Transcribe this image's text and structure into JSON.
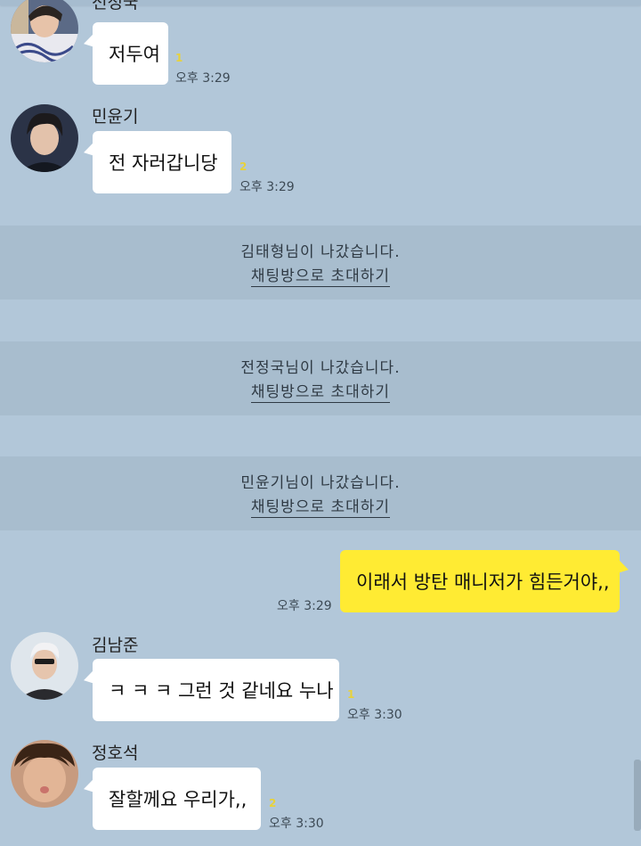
{
  "messages_top": [
    {
      "sender": "전정국",
      "text": "저두여",
      "unread": "1",
      "time": "오후 3:29"
    },
    {
      "sender": "민윤기",
      "text": "전 자러갑니당",
      "unread": "2",
      "time": "오후 3:29"
    }
  ],
  "notices": [
    {
      "text": "김태형님이 나갔습니다.",
      "link": "채팅방으로 초대하기"
    },
    {
      "text": "전정국님이 나갔습니다.",
      "link": "채팅방으로 초대하기"
    },
    {
      "text": "민윤기님이 나갔습니다.",
      "link": "채팅방으로 초대하기"
    }
  ],
  "my_message": {
    "text": "이래서 방탄 매니저가 힘든거야,,",
    "time": "오후 3:29"
  },
  "messages_bottom": [
    {
      "sender": "김남준",
      "text": "ㅋ ㅋ ㅋ  그런 것 같네요 누나",
      "unread": "1",
      "time": "오후 3:30"
    },
    {
      "sender": "정호석",
      "text": "잘할께요 우리가,,",
      "unread": "2",
      "time": "오후 3:30"
    }
  ],
  "colors": {
    "background": "#b2c7d9",
    "notice_band": "#a8bdce",
    "my_bubble": "#ffeb33",
    "other_bubble": "#ffffff",
    "unread": "#e8d23a"
  }
}
